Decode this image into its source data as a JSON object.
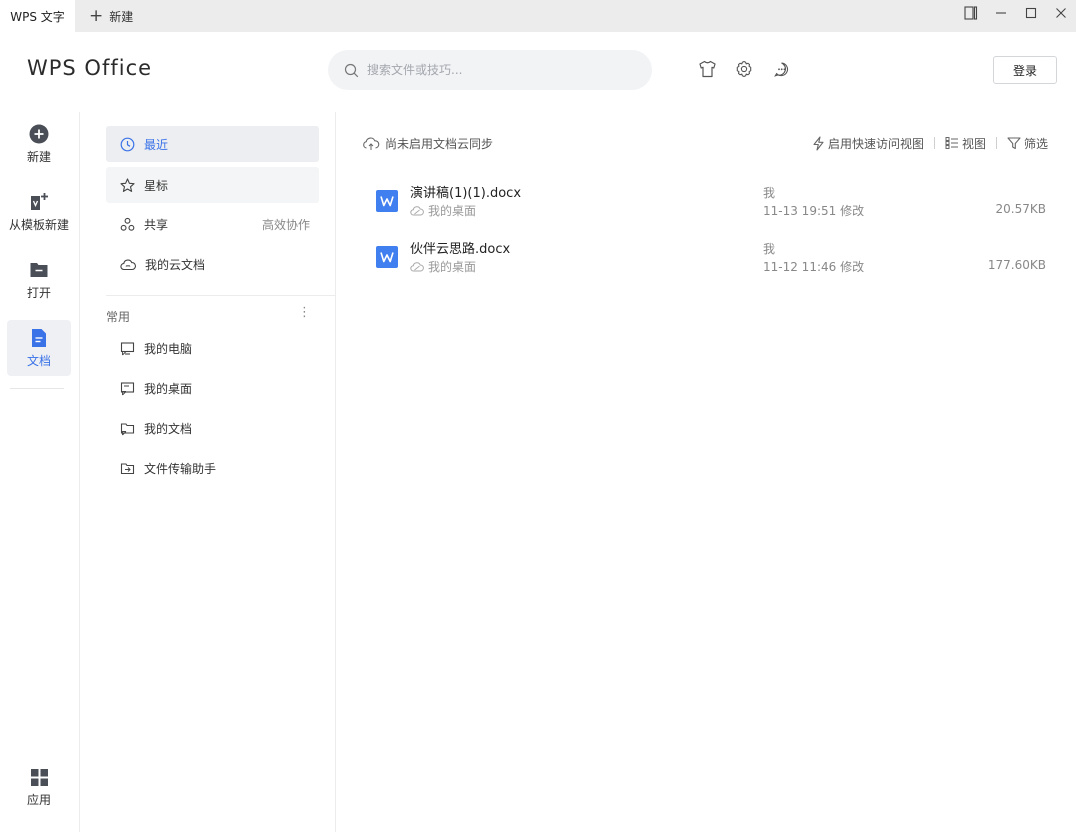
{
  "titlebar": {
    "active_tab": "WPS 文字",
    "new_tab_label": "新建"
  },
  "header": {
    "logo_text": "WPS Office",
    "search_placeholder": "搜索文件或技巧...",
    "login_label": "登录"
  },
  "rail": {
    "items": [
      {
        "label": "新建",
        "icon": "plus-circle-icon"
      },
      {
        "label": "从模板新建",
        "icon": "template-icon"
      },
      {
        "label": "打开",
        "icon": "folder-icon"
      },
      {
        "label": "文档",
        "icon": "document-icon"
      }
    ],
    "apps_label": "应用"
  },
  "nav": {
    "items": [
      {
        "label": "最近",
        "icon": "clock-icon"
      },
      {
        "label": "星标",
        "icon": "star-icon"
      },
      {
        "label": "共享",
        "icon": "share-icon",
        "extra": "高效协作"
      },
      {
        "label": "我的云文档",
        "icon": "cloud-icon"
      }
    ],
    "common_label": "常用",
    "common_items": [
      {
        "label": "我的电脑",
        "icon": "computer-shortcut-icon"
      },
      {
        "label": "我的桌面",
        "icon": "desktop-shortcut-icon"
      },
      {
        "label": "我的文档",
        "icon": "documents-shortcut-icon"
      },
      {
        "label": "文件传输助手",
        "icon": "transfer-icon"
      }
    ]
  },
  "toolbar": {
    "cloud_status": "尚未启用文档云同步",
    "quick_access": "启用快速访问视图",
    "view": "视图",
    "filter": "筛选"
  },
  "files": [
    {
      "name": "演讲稿(1)(1).docx",
      "location": "我的桌面",
      "owner": "我",
      "modified": "11-13 19:51 修改",
      "size": "20.57KB"
    },
    {
      "name": "伙伴云思路.docx",
      "location": "我的桌面",
      "owner": "我",
      "modified": "11-12 11:46 修改",
      "size": "177.60KB"
    }
  ],
  "colors": {
    "accent": "#3a72e8",
    "word_icon": "#3f7ff0"
  }
}
